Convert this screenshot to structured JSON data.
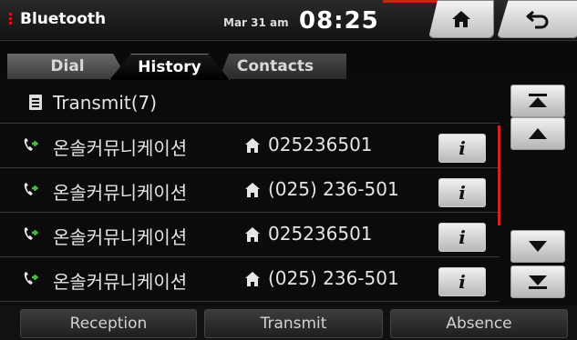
{
  "status": {
    "title": "Bluetooth",
    "date": "Mar 31 am",
    "time": "08:25",
    "home_icon": "home-icon",
    "back_icon": "back-arrow-icon"
  },
  "tabs": [
    {
      "label": "Dial",
      "active": false
    },
    {
      "label": "History",
      "active": true
    },
    {
      "label": "Contacts",
      "active": false
    }
  ],
  "header": {
    "label": "Transmit(7)",
    "icon": "list-document-icon"
  },
  "calls": [
    {
      "name": "온솔커뮤니케이션",
      "number": "025236501",
      "info_label": "i"
    },
    {
      "name": "온솔커뮤니케이션",
      "number": "(025) 236-501",
      "info_label": "i"
    },
    {
      "name": "온솔커뮤니케이션",
      "number": "025236501",
      "info_label": "i"
    },
    {
      "name": "온솔커뮤니케이션",
      "number": "(025) 236-501",
      "info_label": "i"
    }
  ],
  "scroll_buttons": [
    "scroll-top-icon",
    "scroll-up-icon",
    "scroll-down-icon",
    "scroll-bottom-icon"
  ],
  "bottom": {
    "reception": "Reception",
    "transmit": "Transmit",
    "absence": "Absence"
  },
  "colors": {
    "accent_red": "#d1241f",
    "call_arrow_green": "#3fbf3a",
    "background": "#0b0b0b"
  }
}
